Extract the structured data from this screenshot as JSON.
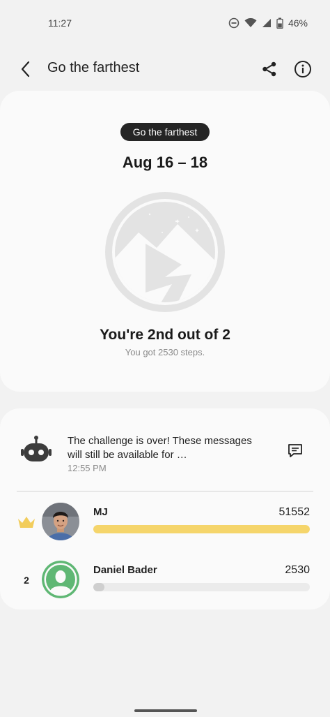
{
  "status_bar": {
    "time": "11:27",
    "battery_percent": "46%",
    "icons": [
      "do-not-disturb-icon",
      "wifi-icon",
      "signal-icon",
      "battery-icon"
    ]
  },
  "app_bar": {
    "title": "Go the farthest",
    "icons": [
      "back-arrow-icon",
      "share-icon",
      "info-icon"
    ]
  },
  "summary": {
    "challenge_label": "Go the farthest",
    "date_range": "Aug 16 – 18",
    "badge_icon": "mountain-road-badge-icon",
    "rank_text": "You're 2nd out of 2",
    "steps_text": "You got 2530 steps."
  },
  "message": {
    "text": "The challenge is over! These messages will still be available for …",
    "time": "12:55 PM",
    "icons": [
      "robot-icon",
      "chat-icon"
    ]
  },
  "leaderboard": [
    {
      "rank_icon": "crown-icon",
      "rank_text": "",
      "name": "MJ",
      "value": "51552",
      "progress": 1.0,
      "bar_color": "#f5d56b"
    },
    {
      "rank_icon": "",
      "rank_text": "2",
      "name": "Daniel Bader",
      "value": "2530",
      "progress": 0.049,
      "bar_color": "#cfcfcf"
    }
  ],
  "colors": {
    "background": "#f2f2f2",
    "card": "#fafafa",
    "pill": "#252525",
    "accent_gold": "#f5d56b",
    "avatar_green": "#5fb774"
  }
}
